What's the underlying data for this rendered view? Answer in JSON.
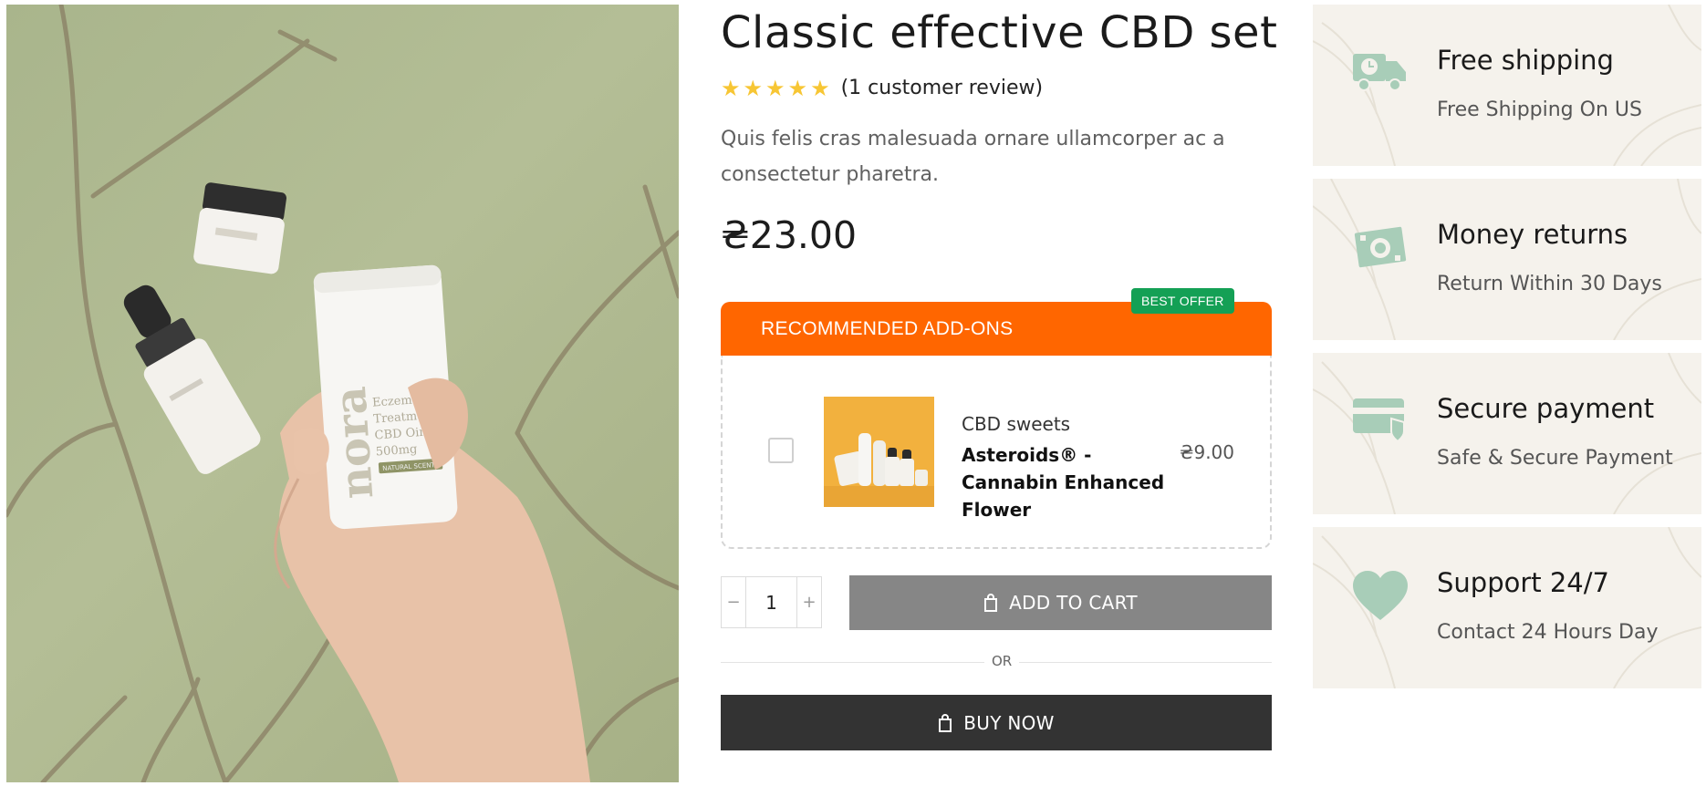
{
  "product": {
    "title": "Classic effective CBD set",
    "stars": 5,
    "review_text": "(1 customer review)",
    "description": "Quis felis cras malesuada ornare ullamcorper ac a consectetur pharetra.",
    "price": "₴23.00",
    "image_label_brand": "nora",
    "image_label_lines": [
      "Eczema",
      "Treatment",
      "CBD Ointment",
      "500mg"
    ],
    "image_label_tag": "NATURAL SCENT"
  },
  "addons": {
    "header": "RECOMMENDED ADD-ONS",
    "badge": "BEST OFFER",
    "item": {
      "checked": false,
      "category": "CBD sweets",
      "name": "Asteroids® - Cannabin Enhanced Flower",
      "price": "₴9.00"
    }
  },
  "cart": {
    "quantity": "1",
    "minus": "−",
    "plus": "+",
    "add_to_cart": "ADD TO CART",
    "or": "OR",
    "buy_now": "BUY NOW"
  },
  "features": [
    {
      "icon": "truck-clock-icon",
      "title": "Free shipping",
      "subtitle": "Free Shipping On US"
    },
    {
      "icon": "money-icon",
      "title": "Money returns",
      "subtitle": "Return Within 30 Days"
    },
    {
      "icon": "card-shield-icon",
      "title": "Secure payment",
      "subtitle": "Safe & Secure Payment"
    },
    {
      "icon": "heart-icon",
      "title": "Support 24/7",
      "subtitle": "Contact 24 Hours Day"
    }
  ],
  "colors": {
    "accent_orange": "#ff6600",
    "badge_green": "#14a055",
    "star_yellow": "#f7c634",
    "feature_bg": "#f5f2ec",
    "feature_icon": "#a8cdb8",
    "add_to_cart_bg": "#868686",
    "buy_now_bg": "#333333"
  }
}
